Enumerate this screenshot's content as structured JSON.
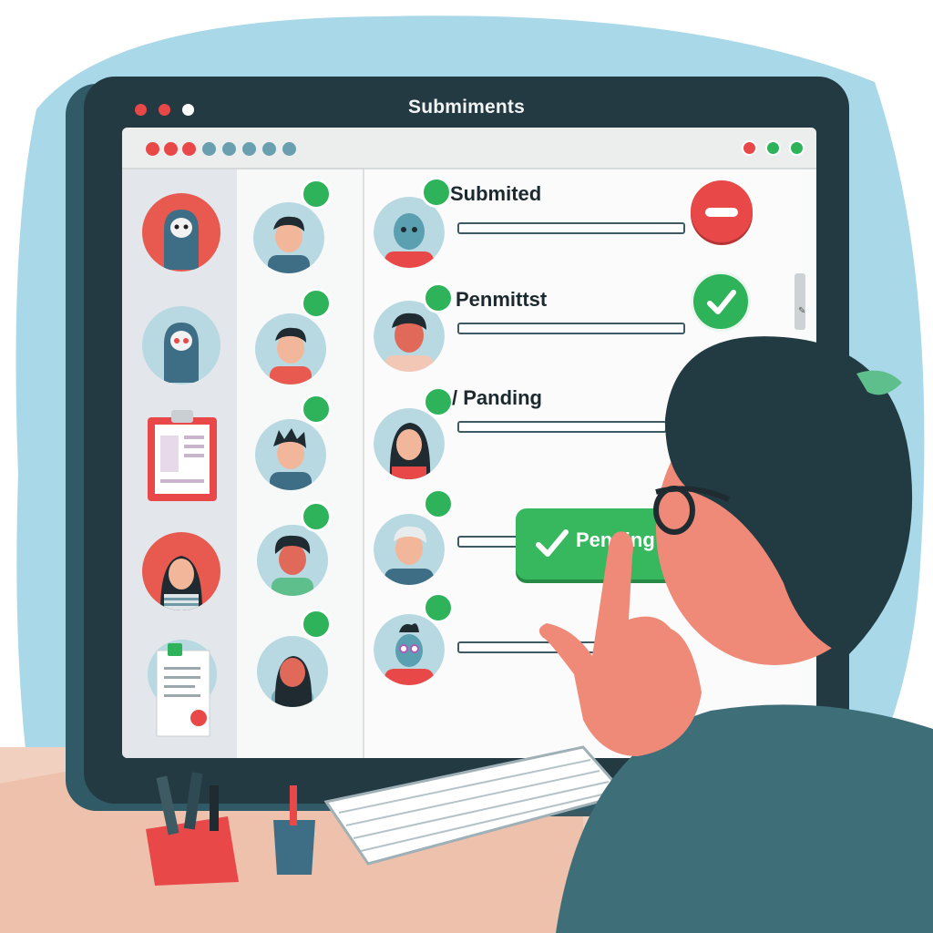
{
  "window": {
    "title": "Submiments"
  },
  "statuses": [
    {
      "label": "Submited"
    },
    {
      "label": "Penmittst"
    },
    {
      "label": "/ Panding"
    }
  ],
  "pending_button": {
    "label": "Pending"
  },
  "sidebar": {
    "items": [
      {
        "icon": "ghost-avatar-icon"
      },
      {
        "icon": "ghost-avatar-icon"
      },
      {
        "icon": "clipboard-icon"
      },
      {
        "icon": "user-avatar-icon"
      },
      {
        "icon": "document-icon"
      }
    ]
  },
  "colors": {
    "background": "#a9d8e8",
    "monitor": "#243a42",
    "accent_green": "#2fb35a",
    "accent_red": "#e84848"
  }
}
